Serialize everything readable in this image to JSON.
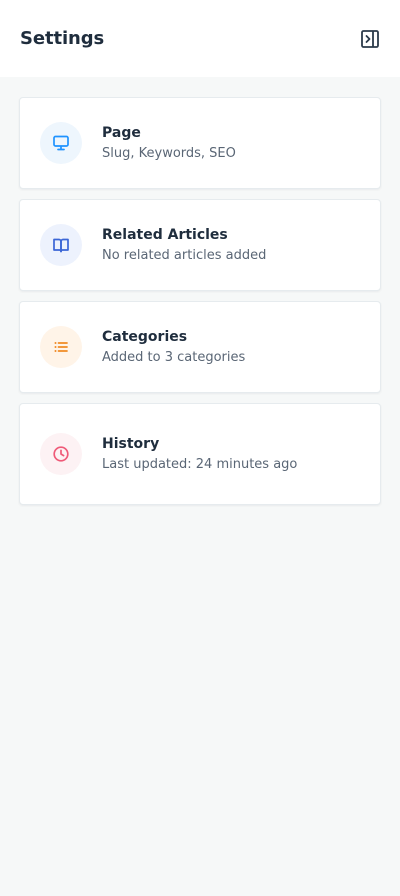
{
  "header": {
    "title": "Settings",
    "toggle_icon": "panel-right-collapse-icon"
  },
  "cards": [
    {
      "title": "Page",
      "subtitle": "Slug, Keywords, SEO",
      "icon": "monitor-icon",
      "accent": "#1f93ff",
      "icon_bg": "#eef6fd"
    },
    {
      "title": "Related Articles",
      "subtitle": "No related articles added",
      "icon": "book-open-icon",
      "accent": "#3b66d6",
      "icon_bg": "#edf2fd"
    },
    {
      "title": "Categories",
      "subtitle": "Added to 3 categories",
      "icon": "list-icon",
      "accent": "#f08a24",
      "icon_bg": "#fff4e8"
    },
    {
      "title": "History",
      "subtitle": "Last updated: 24 minutes ago",
      "icon": "clock-icon",
      "accent": "#ef5a78",
      "icon_bg": "#fdf2f4"
    }
  ]
}
